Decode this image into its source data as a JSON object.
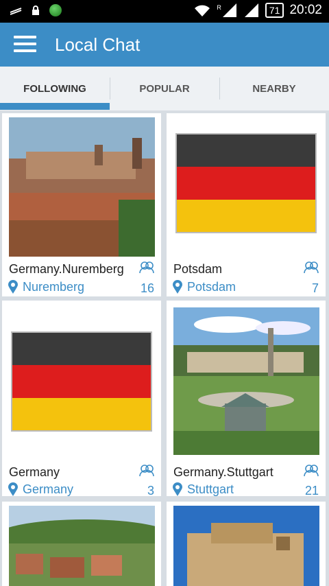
{
  "status_bar": {
    "time": "20:02",
    "battery": "71",
    "network": "R"
  },
  "app": {
    "title": "Local Chat"
  },
  "tabs": [
    {
      "label": "FOLLOWING"
    },
    {
      "label": "POPULAR"
    },
    {
      "label": "NEARBY"
    }
  ],
  "rooms": [
    {
      "name": "Germany.Nuremberg",
      "location": "Nuremberg",
      "count": "16",
      "thumb": "city-photo"
    },
    {
      "name": "Potsdam",
      "location": "Potsdam",
      "count": "7",
      "thumb": "germany-flag"
    },
    {
      "name": "Germany",
      "location": "Germany",
      "count": "3",
      "thumb": "germany-flag"
    },
    {
      "name": "Germany.Stuttgart",
      "location": "Stuttgart",
      "count": "21",
      "thumb": "park-photo"
    }
  ],
  "colors": {
    "accent": "#3c8dc6",
    "flag_black": "#3a3a3a",
    "flag_red": "#dd1d1d",
    "flag_gold": "#f4c20d"
  }
}
